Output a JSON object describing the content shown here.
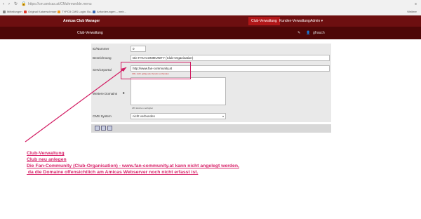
{
  "browser": {
    "url": "https://cm.amicas.at/CMuhrewolde.menu",
    "bookmarks": [
      "Mitteilungen",
      "Original Kaiserschmarr...",
      "TYPO3 CMS Login: Bu...",
      "Anforderungen – meir..."
    ],
    "bookmarks_right": "Weitere"
  },
  "app": {
    "brand": "Amicas Club Manager",
    "nav": [
      "Club-Verwaltung",
      "Kunden-Verwaltung",
      "Admin"
    ],
    "active_nav": "Club-Verwaltung",
    "section_title": "Club-Verwaltung",
    "user": "gfrauch"
  },
  "form": {
    "id_label": "ID/Nummer",
    "id_value": "0",
    "name_label": "Bezeichnung",
    "name_value": "Die FAN-COMMUNITY (Club-Organisation)",
    "portal_label": "Serviceportal",
    "portal_value": "http://www.fan-community.at",
    "portal_error": "URL nicht gültig oder bereits vorhanden",
    "domains_label": "Weitere Domains",
    "domains_hint": "255 Zeichen verfügbar",
    "cms_label": "CMS System",
    "cms_value": "nicht verbunden"
  },
  "annotation": {
    "line1": "Club-Verwaltung",
    "line2": "Club neu anlegen",
    "line3": "Die Fan-Community (Club-Organisation) - www.fan-community.at kann nicht angelegt werden,",
    "line4": " da die Domaine offensichtlich am Amicas Webserver noch nicht erfasst ist."
  },
  "colors": {
    "topbar": "#6d0f10",
    "subbar": "#4e0707",
    "active_tab": "#b11618",
    "annotation": "#d8246a"
  }
}
